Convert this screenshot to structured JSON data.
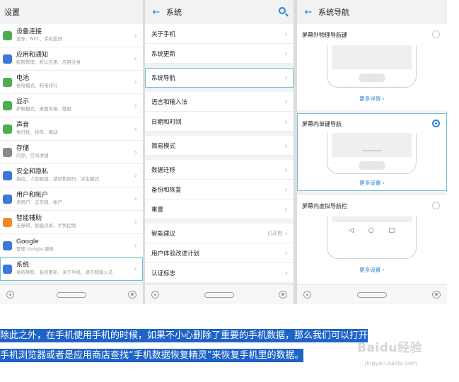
{
  "screen1": {
    "title": "设置",
    "items": [
      {
        "name": "设备连接",
        "sub": "蓝牙、NFC、手机投屏",
        "color": "#4cae4f",
        "icon": "device-link-icon"
      },
      {
        "name": "应用和通知",
        "sub": "权限管理、默认应用、应用分身",
        "color": "#3b78d8",
        "icon": "apps-icon"
      },
      {
        "name": "电池",
        "sub": "省电模式、耗电排行",
        "color": "#4cae4f",
        "icon": "battery-icon"
      },
      {
        "name": "显示",
        "sub": "护眼模式、桌面风格、壁纸",
        "color": "#4cae4f",
        "icon": "display-icon"
      },
      {
        "name": "声音",
        "sub": "免打扰、铃声、振动",
        "color": "#4cae4f",
        "icon": "sound-icon"
      },
      {
        "name": "存储",
        "sub": "内存、空间清理",
        "color": "#8a8a8a",
        "icon": "storage-icon"
      },
      {
        "name": "安全和隐私",
        "sub": "指纹、人脸解锁、锁屏和密码、学生模式",
        "color": "#3b78d8",
        "icon": "security-icon"
      },
      {
        "name": "用户和帐户",
        "sub": "多用户、云空间、帐户",
        "color": "#3b78d8",
        "icon": "user-icon"
      },
      {
        "name": "智能辅助",
        "sub": "无障碍、智能识屏、手势控制",
        "color": "#f08a24",
        "icon": "hand-icon"
      },
      {
        "name": "Google",
        "sub": "管理 Google 服务",
        "color": "#3b78d8",
        "icon": "google-icon"
      },
      {
        "name": "系统",
        "sub": "系统导航、系统更新、关于手机、语言和输入法",
        "color": "#3b78d8",
        "icon": "system-icon"
      }
    ]
  },
  "screen2": {
    "title": "系统",
    "groups": [
      [
        "关于手机",
        "系统更新"
      ],
      [
        "系统导航"
      ],
      [
        "语言和输入法",
        "日期和时间"
      ],
      [
        "简易模式"
      ],
      [
        "数据迁移",
        "备份和恢复",
        "重置"
      ],
      [
        "智能建议",
        "用户体验改进计划",
        "认证标志"
      ]
    ],
    "smart_suggest_status": "已开启"
  },
  "screen3": {
    "title": "系统导航",
    "options": [
      {
        "title": "屏幕外物理导航键",
        "link": "更多详情",
        "selected": false
      },
      {
        "title": "屏幕内单键导航",
        "link": "更多设置",
        "selected": true
      },
      {
        "title": "屏幕内虚拟导航栏",
        "link": "更多设置",
        "selected": false
      }
    ],
    "nav_keys": [
      "◁",
      "○",
      "□"
    ]
  },
  "caption": {
    "line1": "除此之外，在手机使用手机的时候，如果不小心删除了重要的手机数据，那么我们可以打开",
    "line2": "手机浏览器或者是应用商店查找“手机数据恢复精灵”来恢复手机里的数据。"
  },
  "watermark": {
    "brand": "Baidu经验",
    "url": "jingyan.baidu.com"
  },
  "colors": {
    "accent": "#2a84d6",
    "highlight": "#1e63c7"
  }
}
